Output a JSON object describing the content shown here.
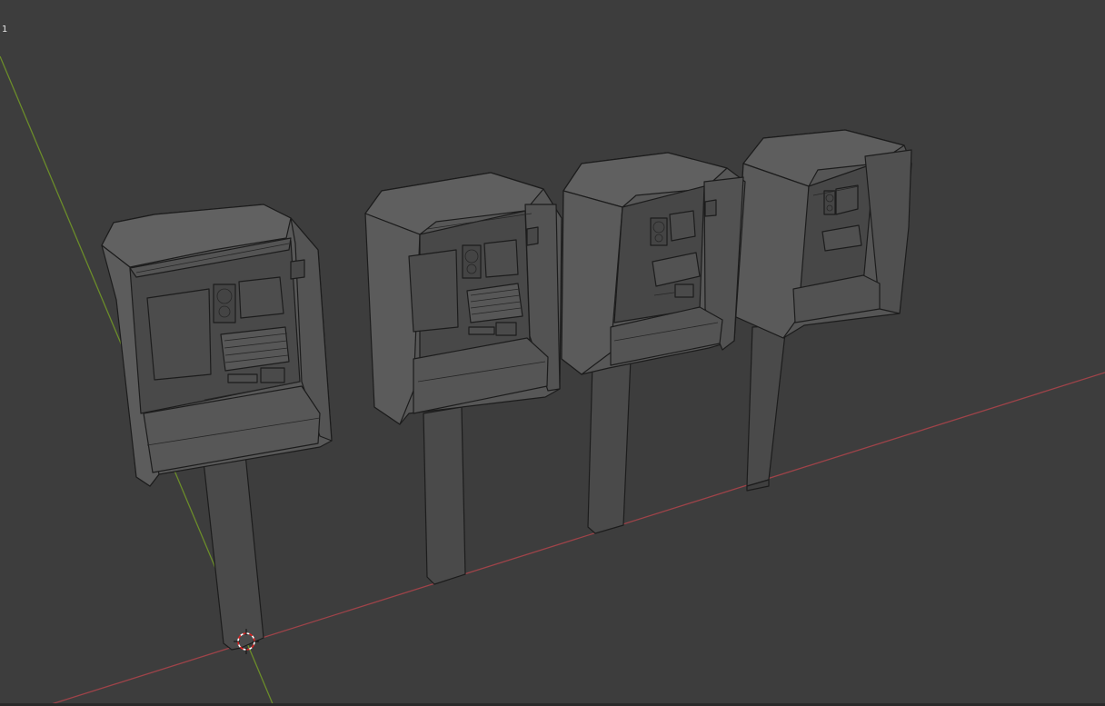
{
  "viewport": {
    "frame_label": "1",
    "background_color": "#3d3d3d",
    "x_axis_color": "#9e4349",
    "y_axis_color": "#6b8c2a",
    "cursor_icon": "3d-cursor-icon",
    "objects": [
      {
        "name": "payphone-kiosk-1"
      },
      {
        "name": "payphone-kiosk-2"
      },
      {
        "name": "payphone-kiosk-3"
      },
      {
        "name": "payphone-kiosk-4"
      }
    ]
  }
}
